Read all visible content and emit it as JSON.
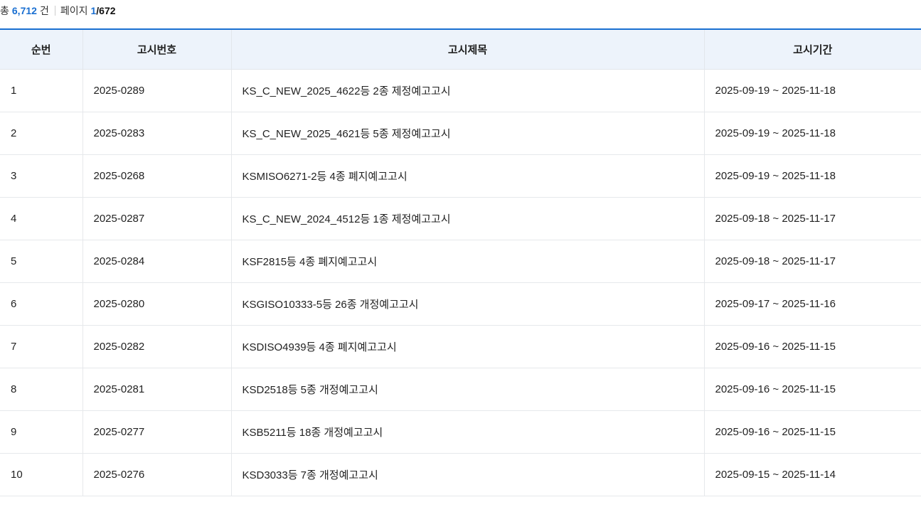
{
  "summary": {
    "total_prefix": "총",
    "total_count": "6,712",
    "total_suffix": "건",
    "page_label": "페이지",
    "current_page": "1",
    "page_divider": "/",
    "total_pages": "672"
  },
  "table": {
    "headers": {
      "no": "순번",
      "id": "고시번호",
      "title": "고시제목",
      "period": "고시기간"
    },
    "rows": [
      {
        "no": "1",
        "id": "2025-0289",
        "title": "KS_C_NEW_2025_4622등 2종 제정예고고시",
        "period": "2025-09-19 ~ 2025-11-18"
      },
      {
        "no": "2",
        "id": "2025-0283",
        "title": "KS_C_NEW_2025_4621등 5종 제정예고고시",
        "period": "2025-09-19 ~ 2025-11-18"
      },
      {
        "no": "3",
        "id": "2025-0268",
        "title": "KSMISO6271-2등 4종 폐지예고고시",
        "period": "2025-09-19 ~ 2025-11-18"
      },
      {
        "no": "4",
        "id": "2025-0287",
        "title": "KS_C_NEW_2024_4512등 1종 제정예고고시",
        "period": "2025-09-18 ~ 2025-11-17"
      },
      {
        "no": "5",
        "id": "2025-0284",
        "title": "KSF2815등 4종 폐지예고고시",
        "period": "2025-09-18 ~ 2025-11-17"
      },
      {
        "no": "6",
        "id": "2025-0280",
        "title": "KSGISO10333-5등 26종 개정예고고시",
        "period": "2025-09-17 ~ 2025-11-16"
      },
      {
        "no": "7",
        "id": "2025-0282",
        "title": "KSDISO4939등 4종 폐지예고고시",
        "period": "2025-09-16 ~ 2025-11-15"
      },
      {
        "no": "8",
        "id": "2025-0281",
        "title": "KSD2518등 5종 개정예고고시",
        "period": "2025-09-16 ~ 2025-11-15"
      },
      {
        "no": "9",
        "id": "2025-0277",
        "title": "KSB5211등 18종 개정예고고시",
        "period": "2025-09-16 ~ 2025-11-15"
      },
      {
        "no": "10",
        "id": "2025-0276",
        "title": "KSD3033등 7종 개정예고고시",
        "period": "2025-09-15 ~ 2025-11-14"
      }
    ]
  },
  "colors": {
    "accent": "#1a6fd1",
    "header_bg": "#edf3fb"
  }
}
